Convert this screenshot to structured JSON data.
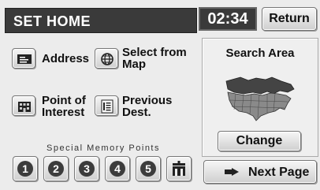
{
  "header": {
    "title": "SET HOME"
  },
  "clock": {
    "time": "02:34"
  },
  "return_button": {
    "label": "Return"
  },
  "menu": {
    "address": {
      "label": "Address",
      "icon": "address-card-icon"
    },
    "select_from_map": {
      "label_line1": "Select from",
      "label_line2": "Map",
      "icon": "globe-icon"
    },
    "point_of_interest": {
      "label_line1": "Point of",
      "label_line2": "Interest",
      "icon": "building-icon"
    },
    "previous_dest": {
      "label_line1": "Previous",
      "label_line2": "Dest.",
      "icon": "list-icon"
    }
  },
  "search_area": {
    "title": "Search Area",
    "change_label": "Change"
  },
  "memory": {
    "label": "Special Memory Points",
    "points": [
      "1",
      "2",
      "3",
      "4",
      "5"
    ],
    "home_icon": "home-icon"
  },
  "next_page": {
    "label": "Next Page",
    "icon": "arrow-right-icon"
  }
}
